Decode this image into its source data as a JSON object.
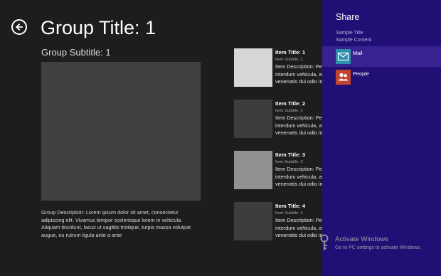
{
  "page": {
    "title": "Group Title: 1",
    "subtitle": "Group Subtitle: 1",
    "description": "Group Description: Lorem ipsum dolor sit amet, consectetur adipiscing elit. Vivamus tempor scelerisque lorem in vehicula. Aliquam tincidunt, lacus ut sagittis tristique, turpis massa volutpat augue, eu rutrum ligula ante a ante"
  },
  "items": [
    {
      "title": "Item Title: 1",
      "subtitle": "Item Subtitle: 1",
      "description_lines": [
        "Item Description: Pelle",
        "interdum vehicula, av",
        "venenatis dui odio in"
      ],
      "image_color": "#d5d7d8"
    },
    {
      "title": "Item Title: 2",
      "subtitle": "Item Subtitle: 2",
      "description_lines": [
        "Item Description: Pelle",
        "interdum vehicula, av",
        "venenatis dui odio in"
      ],
      "image_color": "#3d3d3d"
    },
    {
      "title": "Item Title: 3",
      "subtitle": "Item Subtitle: 3",
      "description_lines": [
        "Item Description: Pelle",
        "interdum vehicula, av",
        "venenatis dui odio in"
      ],
      "image_color": "#8f9192"
    },
    {
      "title": "Item Title: 4",
      "subtitle": "Item Subtitle: 4",
      "description_lines": [
        "Item Description: Pelle",
        "interdum vehicula, av",
        "venenatis dui odio in"
      ],
      "image_color": "#3d3d3d"
    }
  ],
  "share": {
    "heading": "Share",
    "source_title": "Sample Title",
    "source_content": "Sample Content",
    "targets": [
      {
        "label": "Mail",
        "icon": "mail-icon",
        "icon_color": "#2c8fae",
        "selected": true
      },
      {
        "label": "People",
        "icon": "people-icon",
        "icon_color": "#c4452e",
        "selected": false
      }
    ]
  },
  "watermark": {
    "title": "Activate Windows",
    "detail": "Go to PC settings to activate Windows."
  },
  "colors": {
    "app_background": "#1d1d1d",
    "share_background": "#210f76",
    "share_selected": "#372290"
  }
}
